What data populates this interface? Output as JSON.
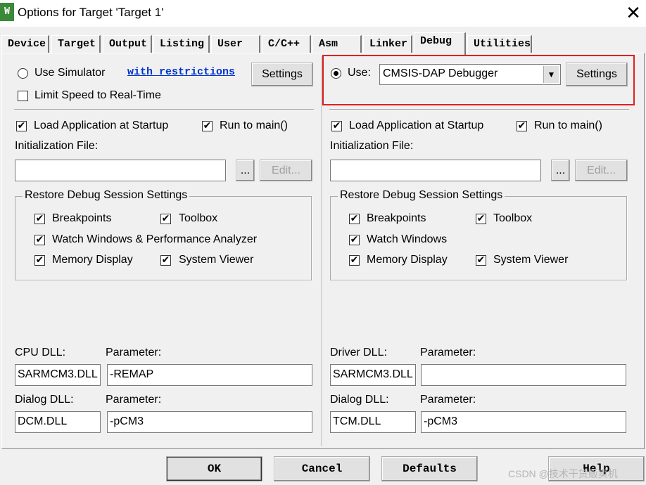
{
  "window": {
    "title": "Options for Target 'Target 1'",
    "icon_text": "W",
    "close_glyph": "✕"
  },
  "tabs": [
    "Device",
    "Target",
    "Output",
    "Listing",
    "User",
    "C/C++",
    "Asm",
    "Linker",
    "Debug",
    "Utilities"
  ],
  "active_tab": "Debug",
  "left": {
    "use_simulator_label": "Use Simulator",
    "restrictions_link": "with restrictions",
    "settings_label": "Settings",
    "limit_speed_label": "Limit Speed to Real-Time",
    "load_app_label": "Load Application at Startup",
    "run_to_main_label": "Run to main()",
    "init_file_label": "Initialization File:",
    "init_file_value": "",
    "browse_label": "...",
    "edit_label": "Edit...",
    "restore_group_label": "Restore Debug Session Settings",
    "breakpoints_label": "Breakpoints",
    "toolbox_label": "Toolbox",
    "watch_label": "Watch Windows & Performance Analyzer",
    "memory_label": "Memory Display",
    "sysview_label": "System Viewer",
    "cpu_dll_label": "CPU DLL:",
    "param_label": "Parameter:",
    "cpu_dll_value": "SARMCM3.DLL",
    "cpu_param_value": "-REMAP",
    "dialog_dll_label": "Dialog DLL:",
    "dialog_param_label": "Parameter:",
    "dialog_dll_value": "DCM.DLL",
    "dialog_param_value": "-pCM3"
  },
  "right": {
    "use_label": "Use:",
    "debugger_value": "CMSIS-DAP Debugger",
    "settings_label": "Settings",
    "load_app_label": "Load Application at Startup",
    "run_to_main_label": "Run to main()",
    "init_file_label": "Initialization File:",
    "init_file_value": "",
    "browse_label": "...",
    "edit_label": "Edit...",
    "restore_group_label": "Restore Debug Session Settings",
    "breakpoints_label": "Breakpoints",
    "toolbox_label": "Toolbox",
    "watch_label": "Watch Windows",
    "memory_label": "Memory Display",
    "sysview_label": "System Viewer",
    "driver_dll_label": "Driver DLL:",
    "param_label": "Parameter:",
    "driver_dll_value": "SARMCM3.DLL",
    "driver_param_value": "",
    "dialog_dll_label": "Dialog DLL:",
    "dialog_param_label": "Parameter:",
    "dialog_dll_value": "TCM.DLL",
    "dialog_param_value": "-pCM3"
  },
  "footer": {
    "ok": "OK",
    "cancel": "Cancel",
    "defaults": "Defaults",
    "help": "Help"
  },
  "watermark": "CSDN @技术干货贩卖机",
  "check_glyph": "✔",
  "highlight_color": "#e02020"
}
